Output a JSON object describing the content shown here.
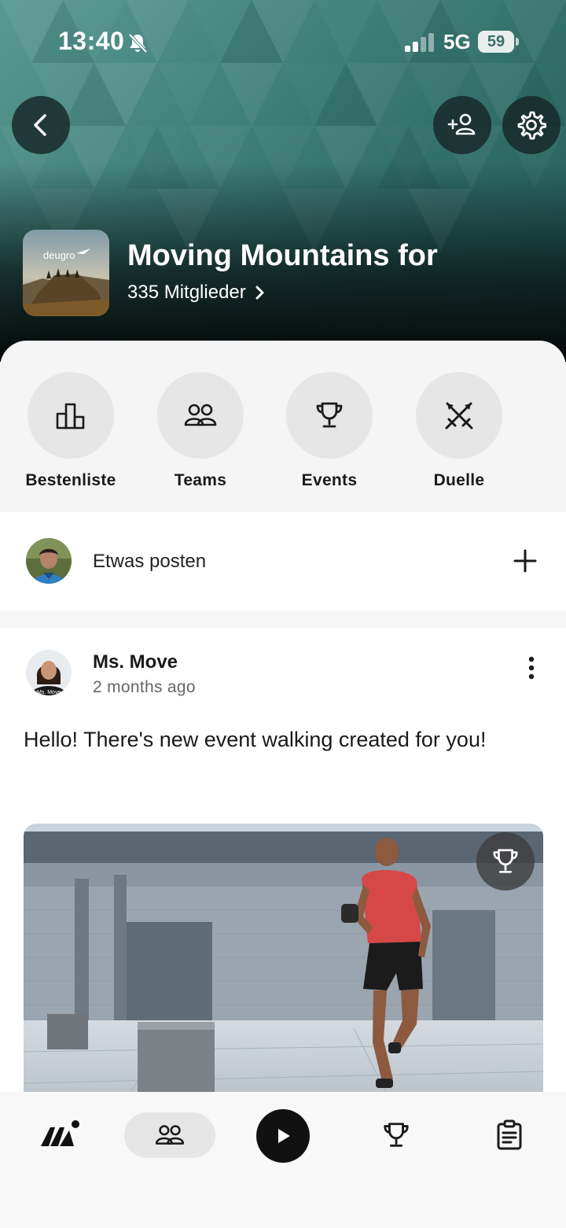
{
  "status_bar": {
    "time": "13:40",
    "network": "5G",
    "battery": "59",
    "bell_icon": "bell-muted-icon",
    "signal_icon": "cell-signal-icon"
  },
  "header": {
    "back_icon": "chevron-left-icon",
    "add_member_icon": "add-person-icon",
    "settings_icon": "gear-icon",
    "group_title": "Moving Mountains for",
    "members_label": "335 Mitglieder",
    "thumb_logo_text": "deugro",
    "bg_color": "#3f7f79"
  },
  "categories": [
    {
      "label": "Bestenliste",
      "icon": "podium-icon"
    },
    {
      "label": "Teams",
      "icon": "people-icon"
    },
    {
      "label": "Events",
      "icon": "trophy-icon"
    },
    {
      "label": "Duelle",
      "icon": "crossed-swords-icon"
    }
  ],
  "composer": {
    "placeholder": "Etwas posten",
    "plus_icon": "plus-icon"
  },
  "post": {
    "author": "Ms. Move",
    "time_ago": "2 months ago",
    "text": "Hello! There's new event walking created for you!",
    "avatar_shirt_text": "Ms. Move",
    "menu_icon": "more-vertical-icon",
    "badge_icon": "trophy-icon"
  },
  "bottom_nav": {
    "items": [
      "home-logo-icon",
      "community-icon",
      "play-icon",
      "trophy-icon",
      "clipboard-icon"
    ],
    "active": "community-icon"
  }
}
